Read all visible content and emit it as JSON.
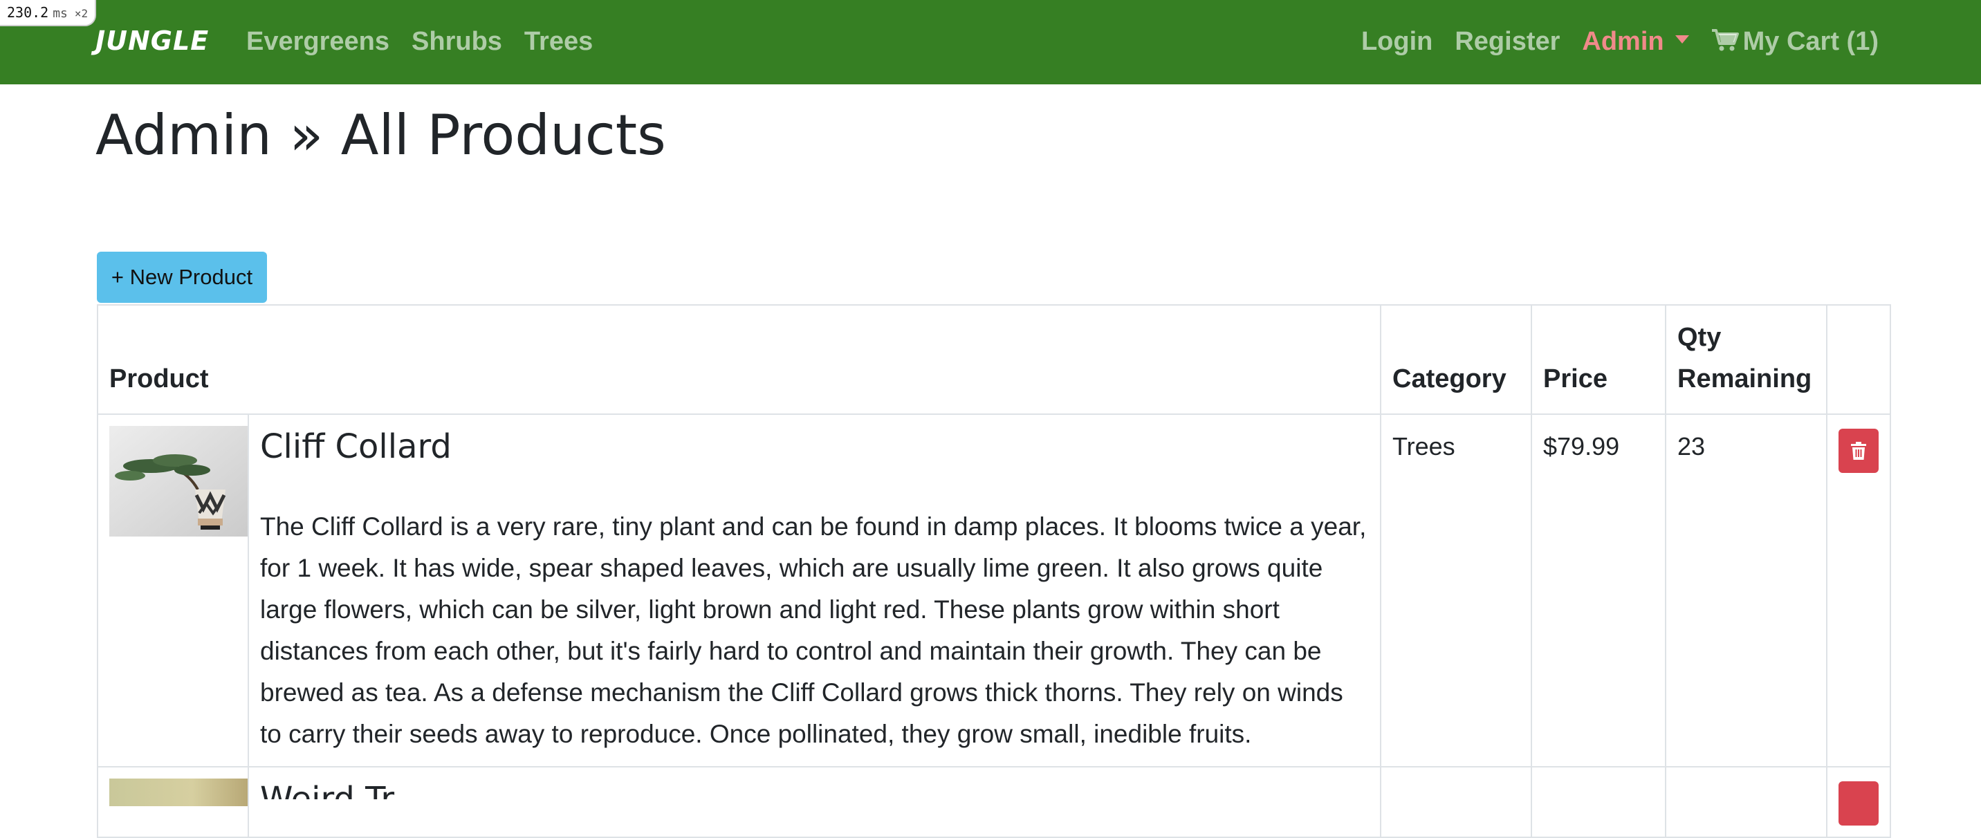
{
  "perf": {
    "time": "230.2",
    "unit": "ms",
    "multiplier": "×2"
  },
  "navbar": {
    "brand": "JUNGLE",
    "left_links": [
      "Evergreens",
      "Shrubs",
      "Trees"
    ],
    "login": "Login",
    "register": "Register",
    "admin": "Admin",
    "cart": "My Cart (1)"
  },
  "page": {
    "title": "Admin » All Products",
    "new_product_button": "+ New Product"
  },
  "table": {
    "headers": {
      "product": "Product",
      "category": "Category",
      "price": "Price",
      "qty": "Qty Remaining"
    },
    "rows": [
      {
        "name": "Cliff Collard",
        "description": "The Cliff Collard is a very rare, tiny plant and can be found in damp places. It blooms twice a year, for 1 week. It has wide, spear shaped leaves, which are usually lime green. It also grows quite large flowers, which can be silver, light brown and light red. These plants grow within short distances from each other, but it's fairly hard to control and maintain their growth. They can be brewed as tea. As a defense mechanism the Cliff Collard grows thick thorns. They rely on winds to carry their seeds away to reproduce. Once pollinated, they grow small, inedible fruits.",
        "category": "Trees",
        "price": "$79.99",
        "qty": "23"
      },
      {
        "name": "Weird Tr..."
      }
    ]
  },
  "colors": {
    "navbar_bg": "#367f23",
    "admin_active": "#f08a8a",
    "new_button": "#5bc0eb",
    "delete_button": "#d9434f"
  },
  "icons": [
    "cart-icon",
    "caret-down-icon",
    "trash-icon"
  ]
}
